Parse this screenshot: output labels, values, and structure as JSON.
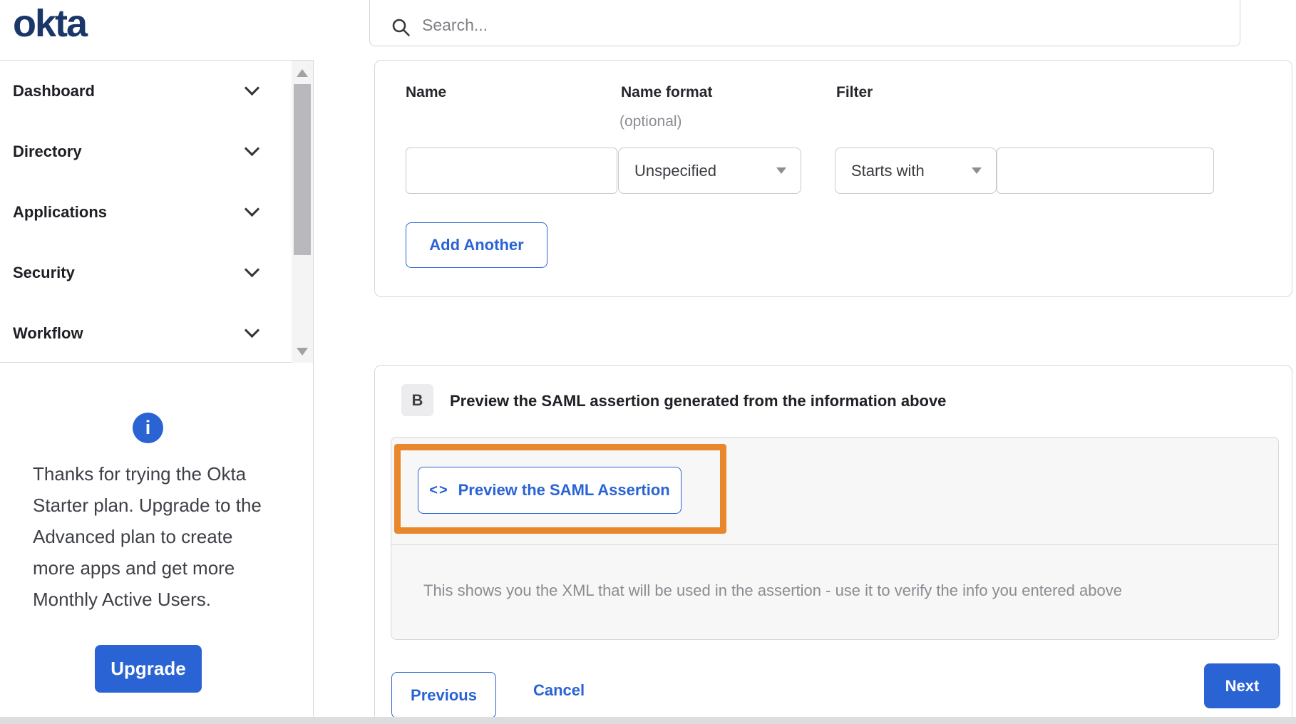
{
  "brand": {
    "logo_text": "okta"
  },
  "header": {
    "search_placeholder": "Search..."
  },
  "sidebar": {
    "items": [
      {
        "label": "Dashboard"
      },
      {
        "label": "Directory"
      },
      {
        "label": "Applications"
      },
      {
        "label": "Security"
      },
      {
        "label": "Workflow"
      }
    ],
    "upgrade": {
      "message": "Thanks for trying the Okta Starter plan. Upgrade to the Advanced plan to create more apps and get more Monthly Active Users.",
      "button_label": "Upgrade"
    }
  },
  "attribute_form": {
    "columns": [
      {
        "label": "Name"
      },
      {
        "label": "Name format",
        "hint": "(optional)"
      },
      {
        "label": "Filter"
      }
    ],
    "name_value": "",
    "name_format_selected": "Unspecified",
    "filter_operator_selected": "Starts with",
    "filter_value": "",
    "add_another_label": "Add Another"
  },
  "preview_section": {
    "step_badge": "B",
    "title": "Preview the SAML assertion generated from the information above",
    "preview_button": {
      "icon_glyph": "<>",
      "label": "Preview the SAML Assertion"
    },
    "description": "This shows you the XML that will be used in the assertion - use it to verify the info you entered above"
  },
  "footer": {
    "previous_label": "Previous",
    "cancel_label": "Cancel",
    "next_label": "Next"
  },
  "colors": {
    "accent_blue": "#2a63d4",
    "logo_navy": "#1b3769",
    "highlight_orange": "#e8872b"
  }
}
